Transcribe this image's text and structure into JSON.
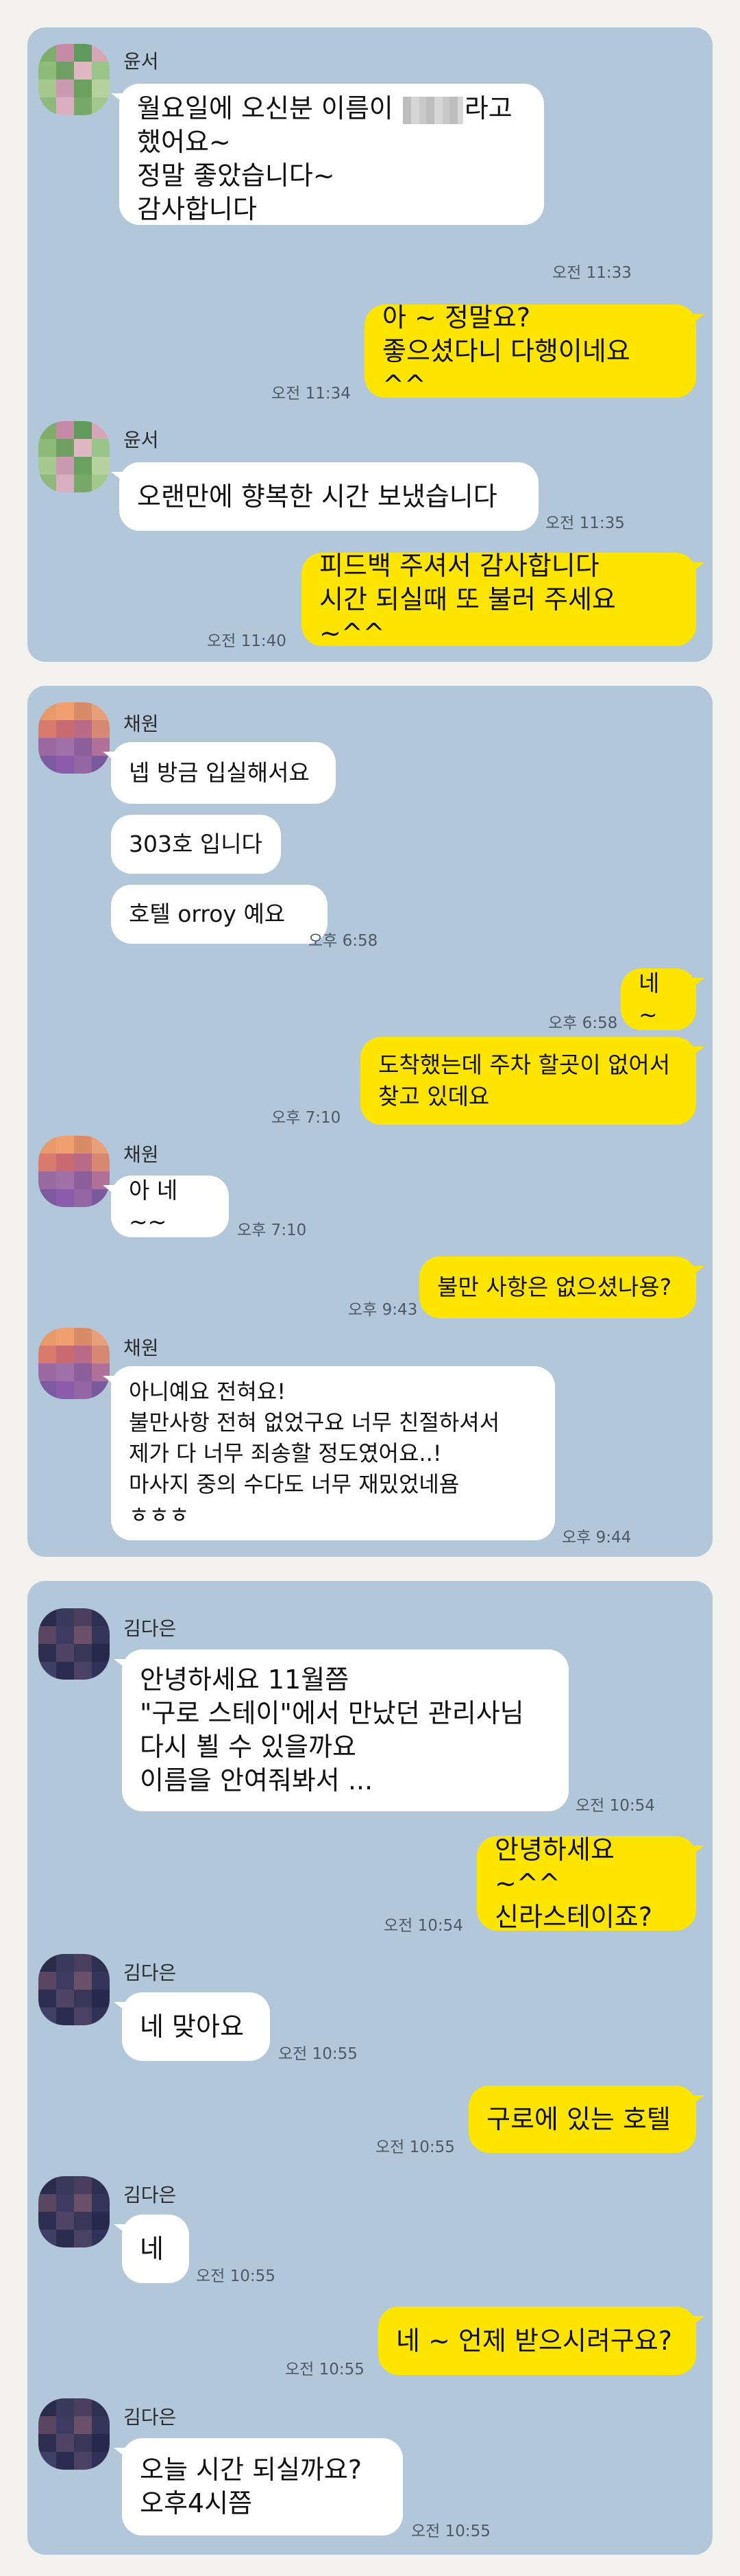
{
  "panel1": {
    "msgs": [
      {
        "sender": "윤서",
        "text_a": "월요일에 오신분 이름이 ",
        "text_b": "라고\n했어요~\n정말 좋았습니다~\n감사합니다",
        "time": "오전 11:33"
      },
      {
        "text": "아 ~ 정말요?\n좋으셨다니 다행이네요 ^^",
        "time": "오전 11:34"
      },
      {
        "sender": "윤서",
        "text": "오랜만에 향복한 시간 보냈습니다",
        "time": "오전 11:35"
      },
      {
        "text": "피드백 주셔서 감사합니다\n시간 되실때 또 불러 주세요 ~^^",
        "time": "오전 11:40"
      }
    ]
  },
  "panel2": {
    "msgs": [
      {
        "sender": "채원",
        "text": "넵 방금 입실해서요"
      },
      {
        "text": "303호 입니다"
      },
      {
        "text": "호텔 orroy 예요",
        "time": "오후 6:58"
      },
      {
        "text": "네 ~",
        "time": "오후 6:58"
      },
      {
        "text": "도착했는데  주차 할곳이 없어서\n찾고 있데요",
        "time": "오후 7:10"
      },
      {
        "sender": "채원",
        "text": "아 네~~",
        "time": "오후 7:10"
      },
      {
        "text": "불만 사항은 없으셨나용?",
        "time": "오후 9:43"
      },
      {
        "sender": "채원",
        "text": "아니예요 전혀요!\n불만사항 전혀 없었구요 너무 친절하셔서\n제가 다 너무 죄송할 정도였어요..!\n마사지 중의 수다도 너무 재밌었네욤\nㅎㅎㅎ",
        "time": "오후 9:44"
      }
    ]
  },
  "panel3": {
    "msgs": [
      {
        "sender": "김다은",
        "text": "안녕하세요 11월쯤\n\"구로 스테이\"에서 만났던 관리사님\n다시 뵐 수 있을까요\n이름을 안여줘봐서 ...",
        "time": "오전 10:54"
      },
      {
        "text": "안녕하세요 ~^^\n신라스테이죠?",
        "time": "오전 10:54"
      },
      {
        "sender": "김다은",
        "text": "네 맞아요",
        "time": "오전 10:55"
      },
      {
        "text": "구로에 있는 호텔",
        "time": "오전 10:55"
      },
      {
        "sender": "김다은",
        "text": "네",
        "time": "오전 10:55"
      },
      {
        "text": "네 ~ 언제 받으시려구요?",
        "time": "오전 10:55"
      },
      {
        "sender": "김다은",
        "text": "오늘  시간 되실까요?\n오후4시쯤",
        "time": "오전 10:55"
      }
    ]
  },
  "colors": {
    "panel_bg": "#b2c7da",
    "incoming_bubble": "#ffffff",
    "outgoing_bubble": "#fee500",
    "page_bg": "#f3f1ed"
  },
  "icons": [
    "profile-avatar-blurred"
  ]
}
